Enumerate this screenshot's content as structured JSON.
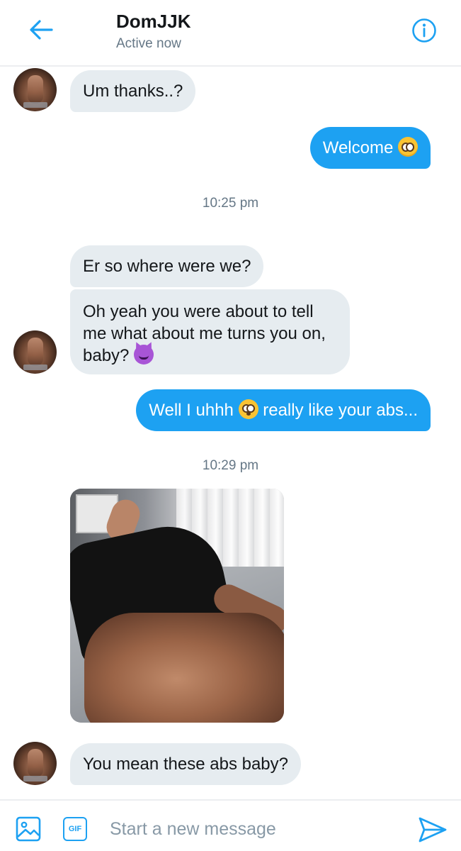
{
  "header": {
    "title": "DomJJK",
    "subtitle": "Active now",
    "back_icon": "arrow-left-icon",
    "info_icon": "info-icon",
    "accent": "#1da1f2"
  },
  "messages": [
    {
      "direction": "in",
      "text": "Um thanks..?"
    },
    {
      "direction": "out",
      "text": "Welcome",
      "emoji": "pleading-face"
    },
    {
      "timestamp": "10:25 pm"
    },
    {
      "direction": "in",
      "text": "Er so where were we?"
    },
    {
      "direction": "in",
      "text": "Oh yeah you were about to tell me what about me turns you on, baby?",
      "emoji": "smiling-devil"
    },
    {
      "direction": "out",
      "text_before": "Well I uhhh",
      "emoji": "flushed-face",
      "text_after": "really like your abs..."
    },
    {
      "timestamp": "10:29 pm"
    },
    {
      "direction": "in",
      "type": "photo"
    },
    {
      "direction": "in",
      "text": "You mean these abs baby?"
    }
  ],
  "composer": {
    "placeholder": "Start a new message",
    "media_icon": "image-icon",
    "gif_label": "GIF",
    "send_icon": "send-icon"
  },
  "colors": {
    "incoming_bubble": "#e6ecf0",
    "outgoing_bubble": "#1da1f2",
    "secondary_text": "#657786"
  }
}
